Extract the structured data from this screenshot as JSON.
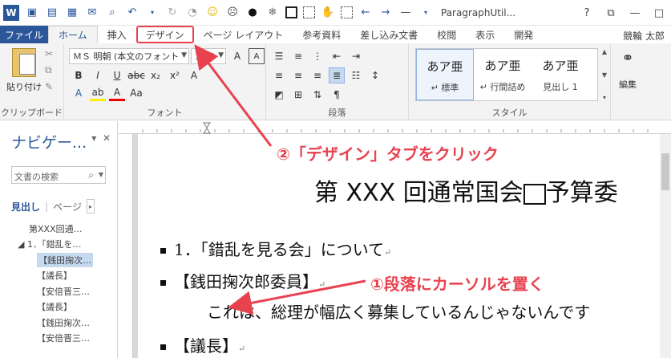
{
  "title": "ParagraphUtil...",
  "window_controls": [
    "?",
    "⧉",
    "—",
    "□"
  ],
  "tabs": {
    "file": "ファイル",
    "items": [
      "ホーム",
      "挿入",
      "デザイン",
      "ページ レイアウト",
      "参考資料",
      "差し込み文書",
      "校閲",
      "表示",
      "開発"
    ]
  },
  "user_name": "競輪 太郎",
  "ribbon": {
    "clipboard": {
      "paste_label": "貼り付け",
      "group_label": "クリップボード"
    },
    "font": {
      "font_name": "ＭＳ 明朝 (本文のフォント",
      "font_size": "10.5",
      "group_label": "フォント"
    },
    "paragraph": {
      "group_label": "段落"
    },
    "styles": {
      "items": [
        {
          "preview": "あア亜",
          "name": "↵ 標準"
        },
        {
          "preview": "あア亜",
          "name": "↵ 行間詰め"
        },
        {
          "preview": "あア亜",
          "name": "見出し 1"
        }
      ],
      "group_label": "スタイル"
    },
    "editing": {
      "label": "編集"
    }
  },
  "nav": {
    "title": "ナビゲー...",
    "search_placeholder": "文書の検索",
    "tabs": [
      "見出し",
      "ページ"
    ],
    "headings": [
      {
        "text": "第XXX回通…",
        "level": 0
      },
      {
        "text": "◢ 1．「錯乱を…",
        "level": 1
      },
      {
        "text": "【銭田掬次…",
        "level": 2,
        "current": true
      },
      {
        "text": "【議長】",
        "level": 2
      },
      {
        "text": "【安倍晋三…",
        "level": 2
      },
      {
        "text": "【議長】",
        "level": 2
      },
      {
        "text": "【銭田掬次…",
        "level": 2
      },
      {
        "text": "【安倍晋三…",
        "level": 2
      }
    ]
  },
  "document": {
    "title_left": "第 XXX 回通常国会",
    "title_right": "予算委",
    "heading1": "1．「錯乱を見る会」について",
    "speaker1": "【銭田掬次郎委員】",
    "body1": "これは、総理が幅広く募集しているんじゃないんです",
    "speaker2": "【議長】",
    "para_mark": "↵"
  },
  "annotations": {
    "step2": "②「デザイン」タブをクリック",
    "step1": "①段落にカーソルを置く"
  },
  "colors": {
    "accent": "#2b579a",
    "annotation": "#e8424f"
  }
}
